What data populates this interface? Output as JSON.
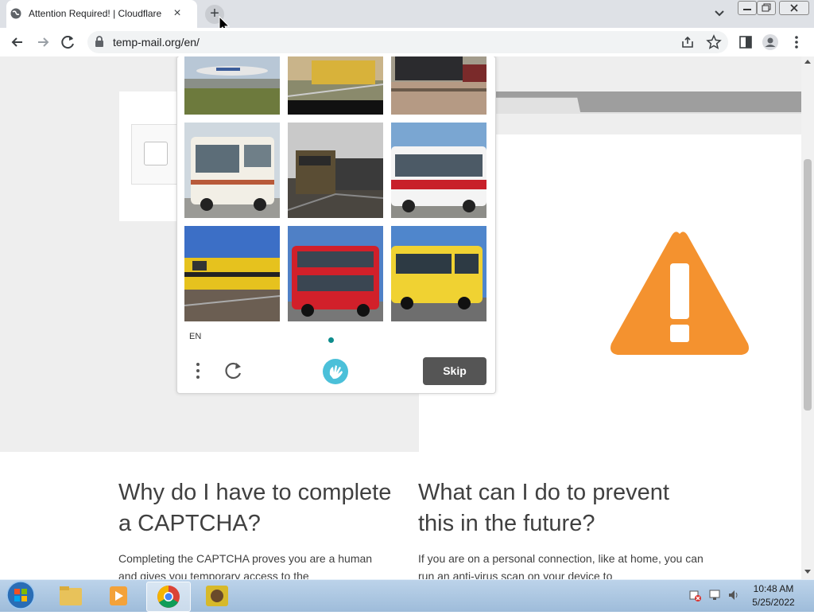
{
  "browser": {
    "tab_title": "Attention Required! | Cloudflare",
    "new_tab_symbol": "+",
    "close_tab_symbol": "×",
    "url": "temp-mail.org/en/",
    "icons": [
      "back-icon",
      "forward-icon",
      "reload-icon",
      "lock-icon",
      "share-icon",
      "star-icon",
      "side-panel-icon",
      "profile-icon",
      "menu-icon"
    ]
  },
  "captcha": {
    "language": "EN",
    "skip_label": "Skip",
    "tiles": [
      "airplane",
      "train",
      "steam-locomotive",
      "bus",
      "train",
      "bus",
      "train",
      "double-decker-bus",
      "yellow-bus"
    ]
  },
  "sections": {
    "why_title": "Why do I have to complete a CAPTCHA?",
    "why_text": "Completing the CAPTCHA proves you are a human and gives you temporary access to the",
    "what_title": "What can I do to prevent this in the future?",
    "what_text": "If you are on a personal connection, like at home, you can run an anti-virus scan on your device to"
  },
  "taskbar": {
    "time": "10:48 AM",
    "date": "5/25/2022"
  },
  "colors": {
    "warning": "#f4922f",
    "skip_button": "#555555",
    "captcha_dot": "#0d8c8c"
  }
}
